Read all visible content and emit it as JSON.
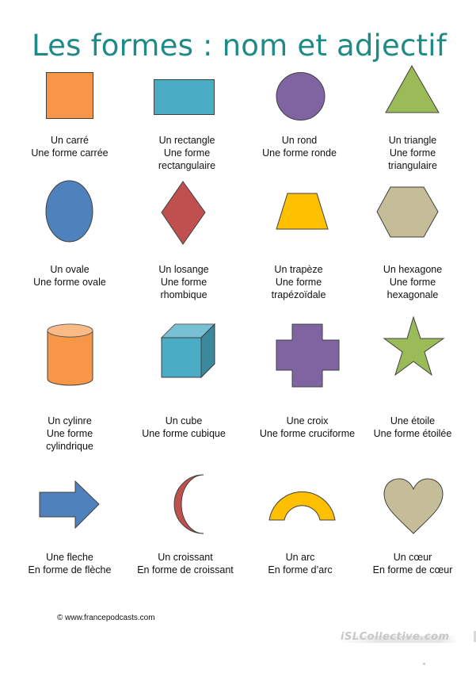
{
  "title": "Les formes : nom et adjectif",
  "colors": {
    "title": "#1f8b87",
    "orange": "#f79646",
    "blue_cyan": "#4bacc6",
    "purple": "#8064a2",
    "green": "#9bbb59",
    "blue": "#4f81bd",
    "red": "#c0504d",
    "yellow": "#ffc000",
    "tan": "#c4bd97"
  },
  "shapes": [
    {
      "icon": "square-icon",
      "name": "Un carré",
      "adjective_lines": [
        "Une forme carrée"
      ]
    },
    {
      "icon": "rectangle-icon",
      "name": "Un rectangle",
      "adjective_lines": [
        "Une forme",
        "rectangulaire"
      ]
    },
    {
      "icon": "circle-icon",
      "name": "Un rond",
      "adjective_lines": [
        "Une forme ronde"
      ]
    },
    {
      "icon": "triangle-icon",
      "name": "Un triangle",
      "adjective_lines": [
        "Une forme",
        "triangulaire"
      ]
    },
    {
      "icon": "oval-icon",
      "name": "Un ovale",
      "adjective_lines": [
        "Une forme ovale"
      ]
    },
    {
      "icon": "rhombus-icon",
      "name": "Un losange",
      "adjective_lines": [
        "Une forme",
        "rhombique"
      ]
    },
    {
      "icon": "trapezoid-icon",
      "name": "Un trapèze",
      "adjective_lines": [
        "Une forme",
        "trapézoïdale"
      ]
    },
    {
      "icon": "hexagon-icon",
      "name": "Un hexagone",
      "adjective_lines": [
        "Une forme",
        "hexagonale"
      ]
    },
    {
      "icon": "cylinder-icon",
      "name": "Un cylinre",
      "adjective_lines": [
        "Une forme",
        "cylindrique"
      ]
    },
    {
      "icon": "cube-icon",
      "name": "Un cube",
      "adjective_lines": [
        "Une forme cubique"
      ]
    },
    {
      "icon": "cross-icon",
      "name": "Une croix",
      "adjective_lines": [
        "Une forme cruciforme"
      ]
    },
    {
      "icon": "star-icon",
      "name": "Une étoile",
      "adjective_lines": [
        "Une forme étoilée"
      ]
    },
    {
      "icon": "arrow-icon",
      "name": "Une fleche",
      "adjective_lines": [
        "En forme de flèche"
      ]
    },
    {
      "icon": "crescent-icon",
      "name": "Un croissant",
      "adjective_lines": [
        "En forme de croissant"
      ]
    },
    {
      "icon": "arc-icon",
      "name": "Un arc",
      "adjective_lines": [
        "En forme d’arc"
      ]
    },
    {
      "icon": "heart-icon",
      "name": "Un cœur",
      "adjective_lines": [
        "En forme de cœur"
      ]
    }
  ],
  "copyright": "© www.francepodcasts.com",
  "watermark": "iSLCollective.com"
}
